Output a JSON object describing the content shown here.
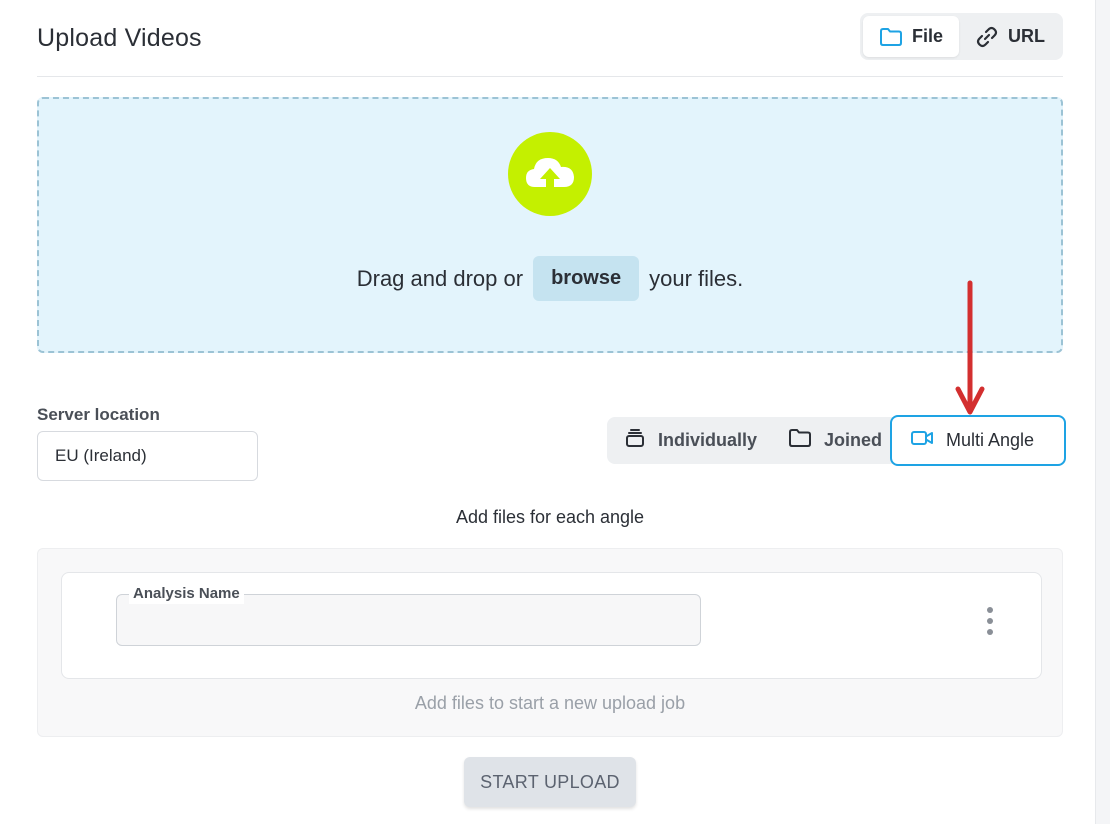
{
  "header": {
    "title": "Upload Videos",
    "source_tabs": [
      {
        "label": "File",
        "icon": "folder-icon",
        "active": true
      },
      {
        "label": "URL",
        "icon": "link-icon",
        "active": false
      }
    ]
  },
  "dropzone": {
    "icon": "cloud-upload-icon",
    "text_before": "Drag and drop or",
    "browse_label": "browse",
    "text_after": "your files."
  },
  "server": {
    "label": "Server location",
    "value": "EU (Ireland)"
  },
  "modes": [
    {
      "label": "Individually",
      "icon": "stack-icon",
      "active": false
    },
    {
      "label": "Joined",
      "icon": "folder-icon",
      "active": false
    },
    {
      "label": "Multi Angle",
      "icon": "video-camera-icon",
      "active": true
    }
  ],
  "angle_hint": "Add files for each angle",
  "job": {
    "analysis_name_label": "Analysis Name",
    "analysis_name_value": "",
    "empty_hint": "Add files to start a new upload job"
  },
  "actions": {
    "start_upload": "START UPLOAD"
  },
  "colors": {
    "accent": "#1ea3e4",
    "upload_icon_bg": "#c4f000",
    "dropzone_bg": "#e3f4fc",
    "annotation_arrow": "#d32f2f"
  }
}
